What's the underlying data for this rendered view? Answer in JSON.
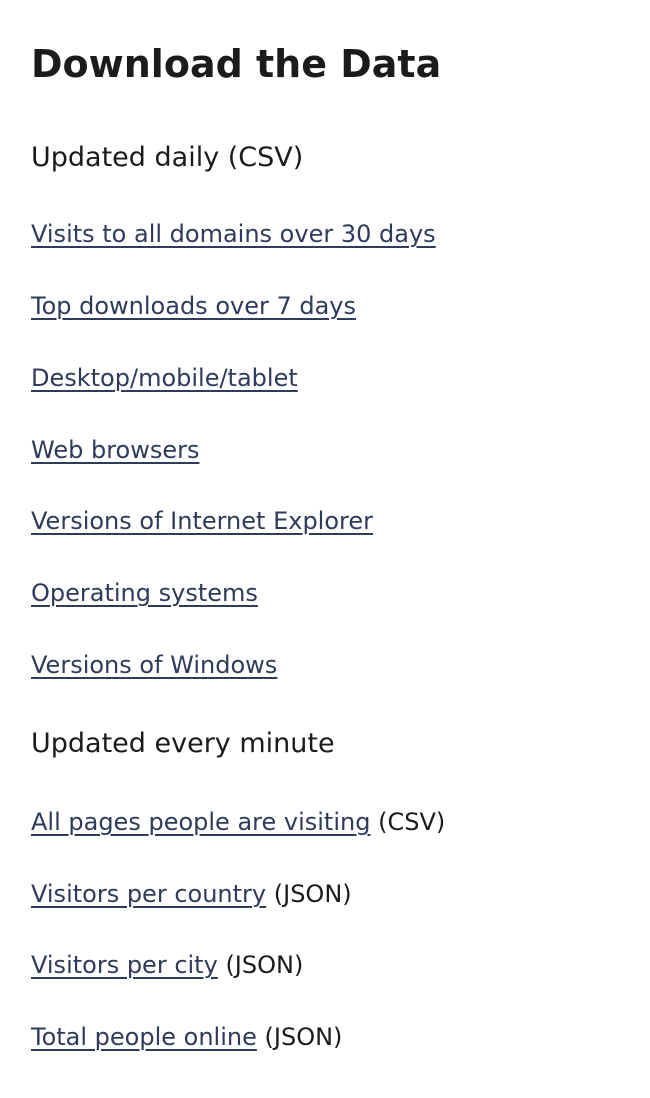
{
  "page": {
    "title": "Download the Data",
    "sections": [
      {
        "heading": "Updated daily (CSV)",
        "links": [
          {
            "label": "Visits to all domains over 30 days"
          },
          {
            "label": "Top downloads over 7 days"
          },
          {
            "label": "Desktop/mobile/tablet"
          },
          {
            "label": "Web browsers"
          },
          {
            "label": "Versions of Internet Explorer"
          },
          {
            "label": "Operating systems"
          },
          {
            "label": "Versions of Windows"
          }
        ]
      },
      {
        "heading": "Updated every minute",
        "links": [
          {
            "label": "All pages people are visiting",
            "format": "(CSV)"
          },
          {
            "label": "Visitors per country",
            "format": "(JSON)"
          },
          {
            "label": "Visitors per city",
            "format": "(JSON)"
          },
          {
            "label": "Total people online",
            "format": "(JSON)"
          }
        ]
      }
    ]
  },
  "colors": {
    "link": "#2e3b5a",
    "text": "#1b1b1b"
  }
}
